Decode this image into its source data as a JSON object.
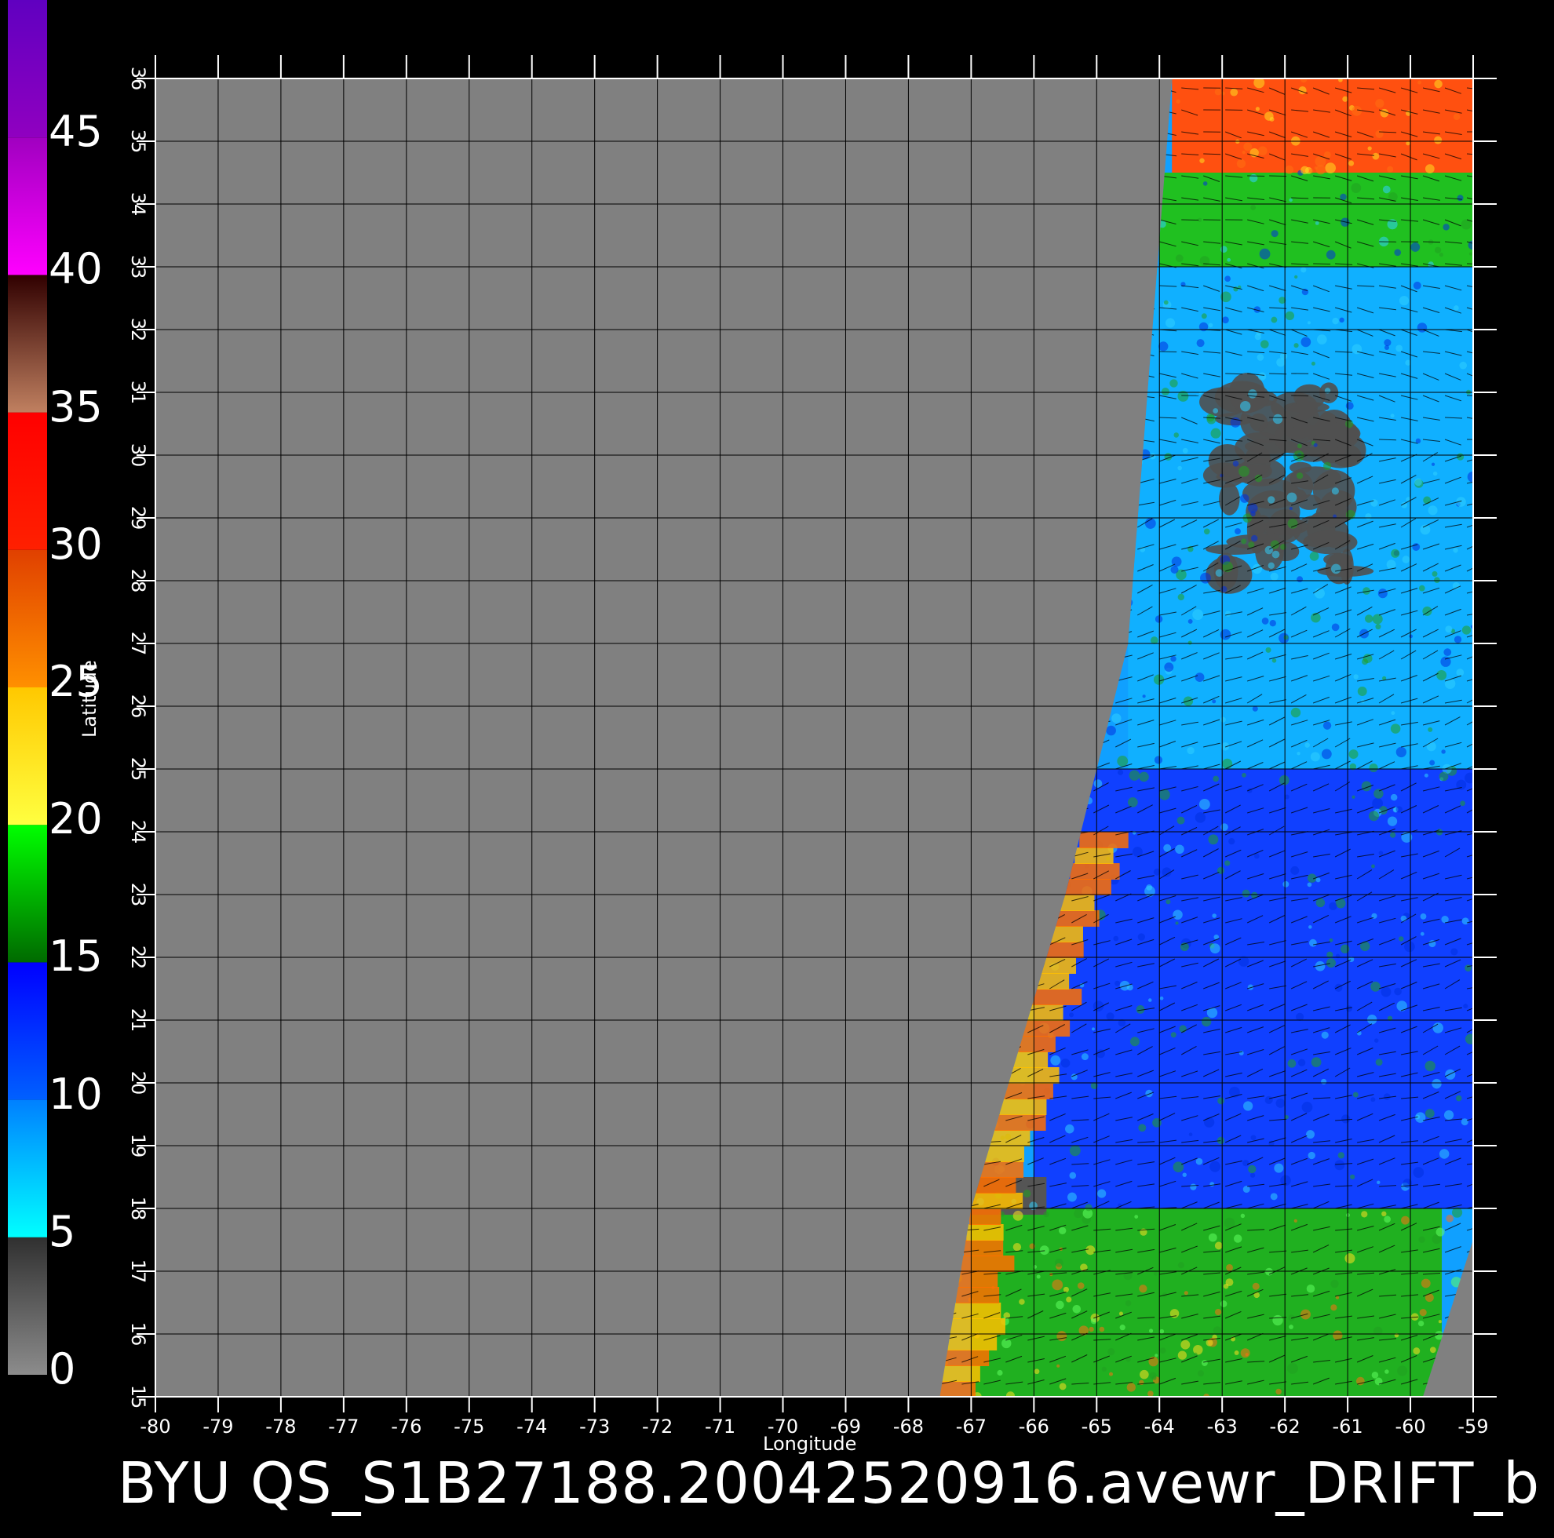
{
  "footer_title": "BYU  QS_S1B27188.20042520916.avewr_DRIFT_b",
  "axes": {
    "xlabel": "Longitude",
    "ylabel": "Latitude",
    "x_ticks": [
      "-80",
      "-79",
      "-78",
      "-77",
      "-76",
      "-75",
      "-74",
      "-73",
      "-72",
      "-71",
      "-70",
      "-69",
      "-68",
      "-67",
      "-66",
      "-65",
      "-64",
      "-63",
      "-62",
      "-61",
      "-60",
      "-59"
    ],
    "y_ticks": [
      "15",
      "16",
      "17",
      "18",
      "19",
      "20",
      "21",
      "22",
      "23",
      "24",
      "25",
      "26",
      "27",
      "28",
      "29",
      "30",
      "31",
      "32",
      "33",
      "34",
      "35",
      "36"
    ],
    "lon_range": [
      -80,
      -59
    ],
    "lat_range": [
      15,
      36
    ]
  },
  "colorbar": {
    "labels": [
      "0",
      "5",
      "10",
      "15",
      "20",
      "25",
      "30",
      "35",
      "40",
      "45"
    ],
    "range": [
      0,
      50
    ],
    "colors": [
      "#8c8c8c",
      "#00ffff",
      "#0000ff",
      "#00ff00",
      "#006a00",
      "#ffff40",
      "#ffc800",
      "#ff8000",
      "#ff0000",
      "#c08060",
      "#300000",
      "#ff00ff",
      "#6000c0"
    ]
  },
  "map": {
    "background_color": "#808080",
    "swath_polygon_lonlat": [
      [
        -63.8,
        36
      ],
      [
        -59,
        36
      ],
      [
        -59,
        17.5
      ],
      [
        -59.8,
        15
      ],
      [
        -67.5,
        15
      ],
      [
        -67,
        18
      ],
      [
        -65.5,
        23
      ],
      [
        -64.5,
        27
      ],
      [
        -63.8,
        36
      ]
    ],
    "regions": [
      {
        "kind": "high-wind",
        "color": "#ff5010",
        "lon": [
          -63.8,
          -59
        ],
        "lat": [
          34.5,
          36
        ]
      },
      {
        "kind": "moderate-wind",
        "color": "#20c020",
        "lon": [
          -64,
          -59
        ],
        "lat": [
          33,
          34.5
        ]
      },
      {
        "kind": "low-wind",
        "color": "#10b0ff",
        "lon": [
          -64.5,
          -59
        ],
        "lat": [
          25,
          33
        ]
      },
      {
        "kind": "low-wind",
        "color": "#1040ff",
        "lon": [
          -66,
          -59
        ],
        "lat": [
          18,
          25
        ]
      },
      {
        "kind": "moderate-wind",
        "color": "#20b020",
        "lon": [
          -67,
          -59.5
        ],
        "lat": [
          15,
          18
        ]
      },
      {
        "kind": "rain-flagged",
        "color": "#505050",
        "lon": [
          -63,
          -61
        ],
        "lat": [
          28,
          31
        ]
      },
      {
        "kind": "land-mask",
        "color": "#555555",
        "lon": [
          -67,
          -65.8
        ],
        "lat": [
          17.9,
          18.5
        ]
      }
    ]
  }
}
